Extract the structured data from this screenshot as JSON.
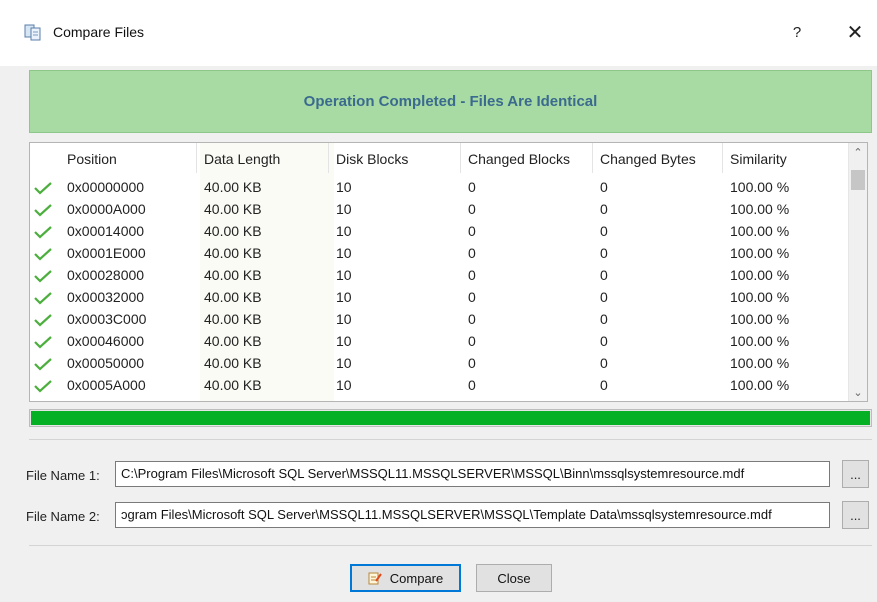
{
  "window": {
    "title": "Compare Files",
    "help_glyph": "?",
    "close_glyph": "✕",
    "icon": "compare-files-icon"
  },
  "banner": {
    "text": "Operation Completed - Files Are Identical",
    "bg_color": "#a8dba3",
    "text_color": "#3b6a8f"
  },
  "table": {
    "columns": [
      "Position",
      "Data Length",
      "Disk Blocks",
      "Changed Blocks",
      "Changed Bytes",
      "Similarity"
    ],
    "rows": [
      [
        "0x00000000",
        "40.00 KB",
        "10",
        "0",
        "0",
        "100.00 %"
      ],
      [
        "0x0000A000",
        "40.00 KB",
        "10",
        "0",
        "0",
        "100.00 %"
      ],
      [
        "0x00014000",
        "40.00 KB",
        "10",
        "0",
        "0",
        "100.00 %"
      ],
      [
        "0x0001E000",
        "40.00 KB",
        "10",
        "0",
        "0",
        "100.00 %"
      ],
      [
        "0x00028000",
        "40.00 KB",
        "10",
        "0",
        "0",
        "100.00 %"
      ],
      [
        "0x00032000",
        "40.00 KB",
        "10",
        "0",
        "0",
        "100.00 %"
      ],
      [
        "0x0003C000",
        "40.00 KB",
        "10",
        "0",
        "0",
        "100.00 %"
      ],
      [
        "0x00046000",
        "40.00 KB",
        "10",
        "0",
        "0",
        "100.00 %"
      ],
      [
        "0x00050000",
        "40.00 KB",
        "10",
        "0",
        "0",
        "100.00 %"
      ],
      [
        "0x0005A000",
        "40.00 KB",
        "10",
        "0",
        "0",
        "100.00 %"
      ]
    ],
    "row_icon": "green-check-icon",
    "scroll_up_glyph": "⌃",
    "scroll_down_glyph": "⌄"
  },
  "progress": {
    "value_percent": 100,
    "color": "#06b025"
  },
  "file1": {
    "label": "File Name 1:",
    "value": "C:\\Program Files\\Microsoft SQL Server\\MSSQL11.MSSQLSERVER\\MSSQL\\Binn\\mssqlsystemresource.mdf",
    "browse_label": "..."
  },
  "file2": {
    "label": "File Name 2:",
    "value": "ɔgram Files\\Microsoft SQL Server\\MSSQL11.MSSQLSERVER\\MSSQL\\Template Data\\mssqlsystemresource.mdf",
    "browse_label": "..."
  },
  "buttons": {
    "compare_label": "Compare",
    "compare_icon": "compare-icon",
    "close_label": "Close"
  }
}
